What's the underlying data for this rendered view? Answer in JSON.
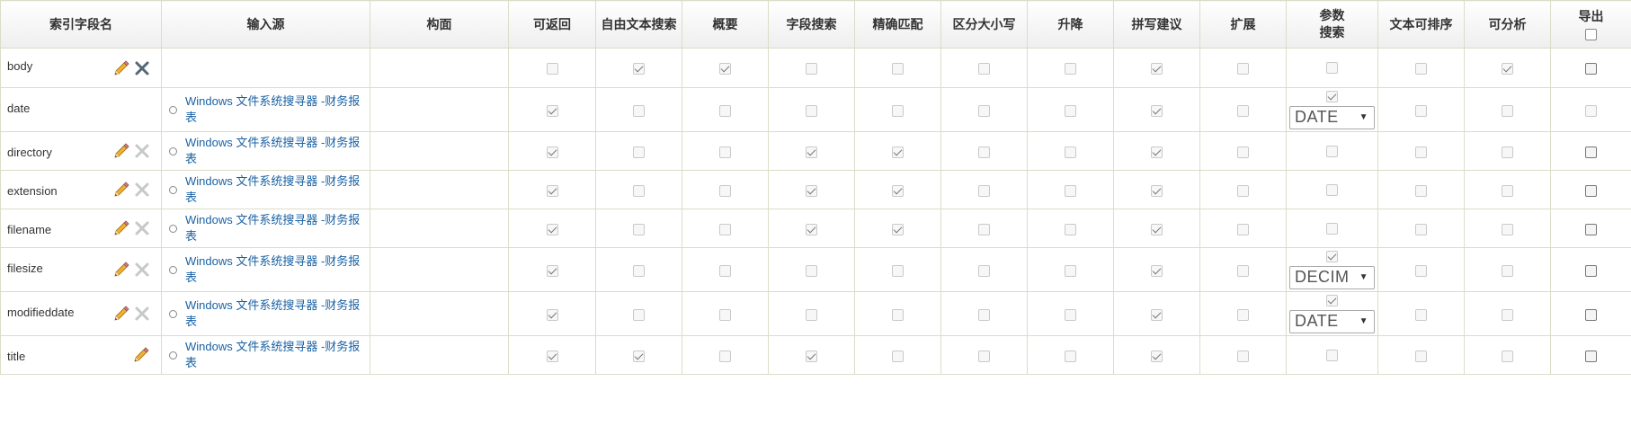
{
  "headers": {
    "field": "索引字段名",
    "source": "输入源",
    "facet": "构面",
    "retrievable": "可返回",
    "fulltext": "自由文本搜索",
    "summary": "概要",
    "fieldsearch": "字段搜索",
    "exact": "精确匹配",
    "casesens": "区分大小写",
    "sort": "升降",
    "spell": "拼写建议",
    "expand": "扩展",
    "param_line1": "参数",
    "param_line2": "搜索",
    "textsort": "文本可排序",
    "analyzable": "可分析",
    "export": "导出"
  },
  "source_link": "Windows 文件系统搜寻器 -财务报表",
  "rows": [
    {
      "name": "body",
      "source": "",
      "checks": [
        false,
        true,
        true,
        false,
        false,
        false,
        false,
        true,
        false
      ],
      "param": {
        "checked": false,
        "select": ""
      },
      "textsort": false,
      "analyzable": true
    },
    {
      "name": "date",
      "source": "Windows 文件系统搜寻器 -财务报表",
      "checks": [
        true,
        false,
        false,
        false,
        false,
        false,
        false,
        true,
        false
      ],
      "param": {
        "checked": true,
        "select": "DATE"
      },
      "textsort": false,
      "analyzable": false
    },
    {
      "name": "directory",
      "source": "Windows 文件系统搜寻器 -财务报表",
      "checks": [
        true,
        false,
        false,
        true,
        true,
        false,
        false,
        true,
        false
      ],
      "param": {
        "checked": false,
        "select": ""
      },
      "textsort": false,
      "analyzable": false
    },
    {
      "name": "extension",
      "source": "Windows 文件系统搜寻器 -财务报表",
      "checks": [
        true,
        false,
        false,
        true,
        true,
        false,
        false,
        true,
        false
      ],
      "param": {
        "checked": false,
        "select": ""
      },
      "textsort": false,
      "analyzable": false
    },
    {
      "name": "filename",
      "source": "Windows 文件系统搜寻器 -财务报表",
      "checks": [
        true,
        false,
        false,
        true,
        true,
        false,
        false,
        true,
        false
      ],
      "param": {
        "checked": false,
        "select": ""
      },
      "textsort": false,
      "analyzable": false
    },
    {
      "name": "filesize",
      "source": "Windows 文件系统搜寻器 -财务报表",
      "checks": [
        true,
        false,
        false,
        false,
        false,
        false,
        false,
        true,
        false
      ],
      "param": {
        "checked": true,
        "select": "DECIM"
      },
      "textsort": false,
      "analyzable": false
    },
    {
      "name": "modifieddate",
      "source": "Windows 文件系统搜寻器 -财务报表",
      "checks": [
        true,
        false,
        false,
        false,
        false,
        false,
        false,
        true,
        false
      ],
      "param": {
        "checked": true,
        "select": "DATE"
      },
      "textsort": false,
      "analyzable": false
    },
    {
      "name": "title",
      "source": "Windows 文件系统搜寻器 -财务报表",
      "checks": [
        true,
        true,
        false,
        true,
        false,
        false,
        false,
        true,
        false
      ],
      "param": {
        "checked": false,
        "select": ""
      },
      "textsort": false,
      "analyzable": false
    }
  ],
  "colors": {
    "link": "#1a62a4",
    "pencil": "#e0a020",
    "delete_active": "#556677",
    "delete_disabled": "#c8c8c8"
  }
}
